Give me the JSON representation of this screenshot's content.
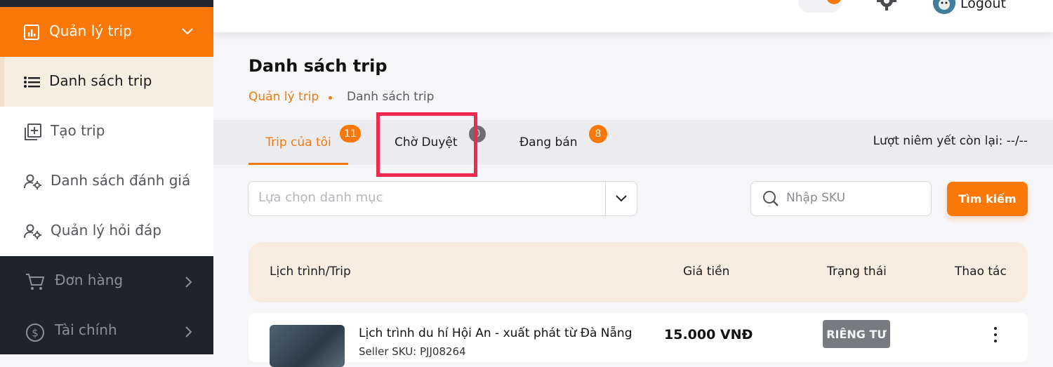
{
  "sidebar": {
    "items": [
      {
        "label": "Quản lý trip",
        "icon": "chart-icon"
      },
      {
        "label": "Danh sách trip",
        "icon": "list-icon"
      },
      {
        "label": "Tạo trip",
        "icon": "add-box-icon"
      },
      {
        "label": "Danh sách đánh giá",
        "icon": "user-gear-icon"
      },
      {
        "label": "Quản lý hỏi đáp",
        "icon": "user-gear-icon"
      },
      {
        "label": "Đơn hàng",
        "icon": "cart-icon"
      },
      {
        "label": "Tài chính",
        "icon": "dollar-icon"
      }
    ]
  },
  "topbar": {
    "logout_label": "Logout"
  },
  "page": {
    "title": "Danh sách trip",
    "breadcrumb": [
      "Quản lý trip",
      "Danh sách trip"
    ]
  },
  "tabs": [
    {
      "label": "Trip của tôi",
      "count": "11"
    },
    {
      "label": "Chờ Duyệt",
      "count": "0"
    },
    {
      "label": "Đang bán",
      "count": "8"
    }
  ],
  "remaining_listing_label": "Lượt niêm yết còn lại: --/--",
  "filters": {
    "category_placeholder": "Lựa chọn danh mục",
    "sku_placeholder": "Nhập SKU",
    "search_label": "Tìm kiếm"
  },
  "table": {
    "headers": [
      "Lịch trình/Trip",
      "Giá tiền",
      "Trạng thái",
      "Thao tác"
    ],
    "rows": [
      {
        "title": "Lịch trình du hí Hội An - xuất phát từ Đà Nẵng",
        "sku": "Seller SKU: PJJ08264",
        "price": "15.000 VNĐ",
        "status": "RIÊNG TƯ"
      }
    ]
  },
  "colors": {
    "accent": "#fb7808",
    "sidebar_bg": "#1f242b",
    "highlight": "#f0294e"
  }
}
